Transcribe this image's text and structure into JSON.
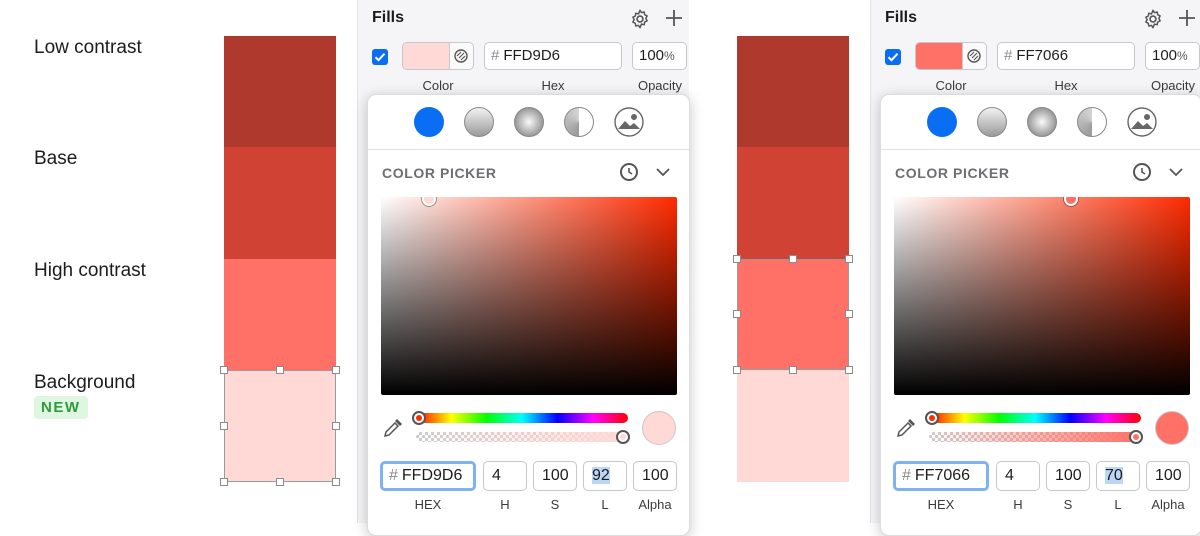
{
  "labels": {
    "low_contrast": "Low contrast",
    "base": "Base",
    "high_contrast": "High contrast",
    "background": "Background",
    "new_badge": "NEW"
  },
  "swatch_colors": {
    "low_contrast": "#B0392D",
    "base": "#D04234",
    "high_contrast": "#FF7066",
    "background": "#FFD9D6"
  },
  "panels": [
    {
      "fills_title": "Fills",
      "fill_color": "#FFD9D6",
      "hex_value": "FFD9D6",
      "opacity_value": "100",
      "opacity_unit": "%",
      "color_label": "Color",
      "hex_label": "Hex",
      "opacity_label": "Opacity",
      "color_picker_title": "COLOR PICKER",
      "fill_type_icons": [
        "solid-fill-icon",
        "linear-gradient-icon",
        "radial-gradient-icon",
        "angular-gradient-icon",
        "image-fill-icon"
      ],
      "hue_color": "#FF2A00",
      "inputs": {
        "hex": "FFD9D6",
        "h": "4",
        "s": "100",
        "l": "92",
        "alpha": "100"
      },
      "input_labels": {
        "hex": "HEX",
        "h": "H",
        "s": "S",
        "l": "L",
        "alpha": "Alpha"
      }
    },
    {
      "fills_title": "Fills",
      "fill_color": "#FF7066",
      "hex_value": "FF7066",
      "opacity_value": "100",
      "opacity_unit": "%",
      "color_label": "Color",
      "hex_label": "Hex",
      "opacity_label": "Opacity",
      "color_picker_title": "COLOR PICKER",
      "fill_type_icons": [
        "solid-fill-icon",
        "linear-gradient-icon",
        "radial-gradient-icon",
        "angular-gradient-icon",
        "image-fill-icon"
      ],
      "hue_color": "#FF2A00",
      "inputs": {
        "hex": "FF7066",
        "h": "4",
        "s": "100",
        "l": "70",
        "alpha": "100"
      },
      "input_labels": {
        "hex": "HEX",
        "h": "H",
        "s": "S",
        "l": "L",
        "alpha": "Alpha"
      }
    }
  ],
  "accent_color": "#0A6EF5"
}
